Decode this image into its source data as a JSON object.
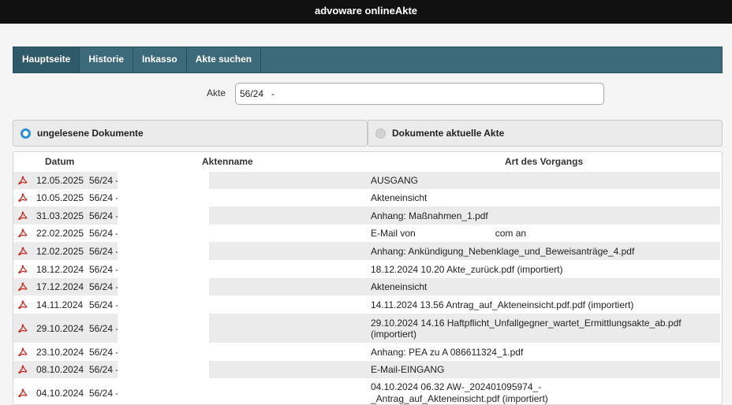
{
  "app": {
    "title": "advoware onlineAkte"
  },
  "nav": {
    "items": [
      {
        "label": "Hauptseite",
        "active": true
      },
      {
        "label": "Historie"
      },
      {
        "label": "Inkasso"
      },
      {
        "label": "Akte suchen"
      }
    ]
  },
  "akte": {
    "label": "Akte",
    "value": "56/24   -"
  },
  "tabs": {
    "unread": {
      "label": "ungelesene Dokumente",
      "selected": true
    },
    "current": {
      "label": "Dokumente aktuelle Akte",
      "selected": false
    }
  },
  "table": {
    "columns": {
      "datum": "Datum",
      "aktenname": "Aktenname",
      "art": "Art des Vorgangs"
    },
    "rows": [
      {
        "date": "12.05.2025",
        "akte": "56/24 -",
        "art": "AUSGANG"
      },
      {
        "date": "10.05.2025",
        "akte": "56/24 -",
        "art": "Akteneinsicht"
      },
      {
        "date": "31.03.2025",
        "akte": "56/24 -",
        "art": "Anhang: Maßnahmen_1.pdf"
      },
      {
        "date": "22.02.2025",
        "akte": "56/24 -",
        "art_prefix": "E-Mail von",
        "art_middle": "com an",
        "art": ""
      },
      {
        "date": "12.02.2025",
        "akte": "56/24 -",
        "art": "Anhang: Ankündigung_Nebenklage_und_Beweisanträge_4.pdf"
      },
      {
        "date": "18.12.2024",
        "akte": "56/24 -",
        "art": "18.12.2024 10.20 Akte_zurück.pdf (importiert)"
      },
      {
        "date": "17.12.2024",
        "akte": "56/24 -",
        "art": "Akteneinsicht"
      },
      {
        "date": "14.11.2024",
        "akte": "56/24 -",
        "art": "14.11.2024 13.56 Antrag_auf_Akteneinsicht.pdf.pdf (importiert)"
      },
      {
        "date": "29.10.2024",
        "akte": "56/24 -",
        "art": "29.10.2024 14.16 Haftpflicht_Unfallgegner_wartet_Ermittlungsakte_ab.pdf (importiert)"
      },
      {
        "date": "23.10.2024",
        "akte": "56/24 -",
        "art": "Anhang: PEA zu A 086611324_1.pdf"
      },
      {
        "date": "08.10.2024",
        "akte": "56/24 -",
        "art": "E-Mail-EINGANG"
      },
      {
        "date": "04.10.2024",
        "akte": "56/24 -",
        "art_line1": "04.10.2024 06.32 AW-_202401095974_-",
        "art_line2": "_Antrag_auf_Akteneinsicht.pdf (importiert)",
        "art": ""
      }
    ]
  },
  "icons": {
    "row_icon": "pdf-icon"
  },
  "colors": {
    "topbar": "#111111",
    "nav": "#3c6a7a",
    "radio_on": "#2a8fd4",
    "pdf": "#c8281e"
  }
}
